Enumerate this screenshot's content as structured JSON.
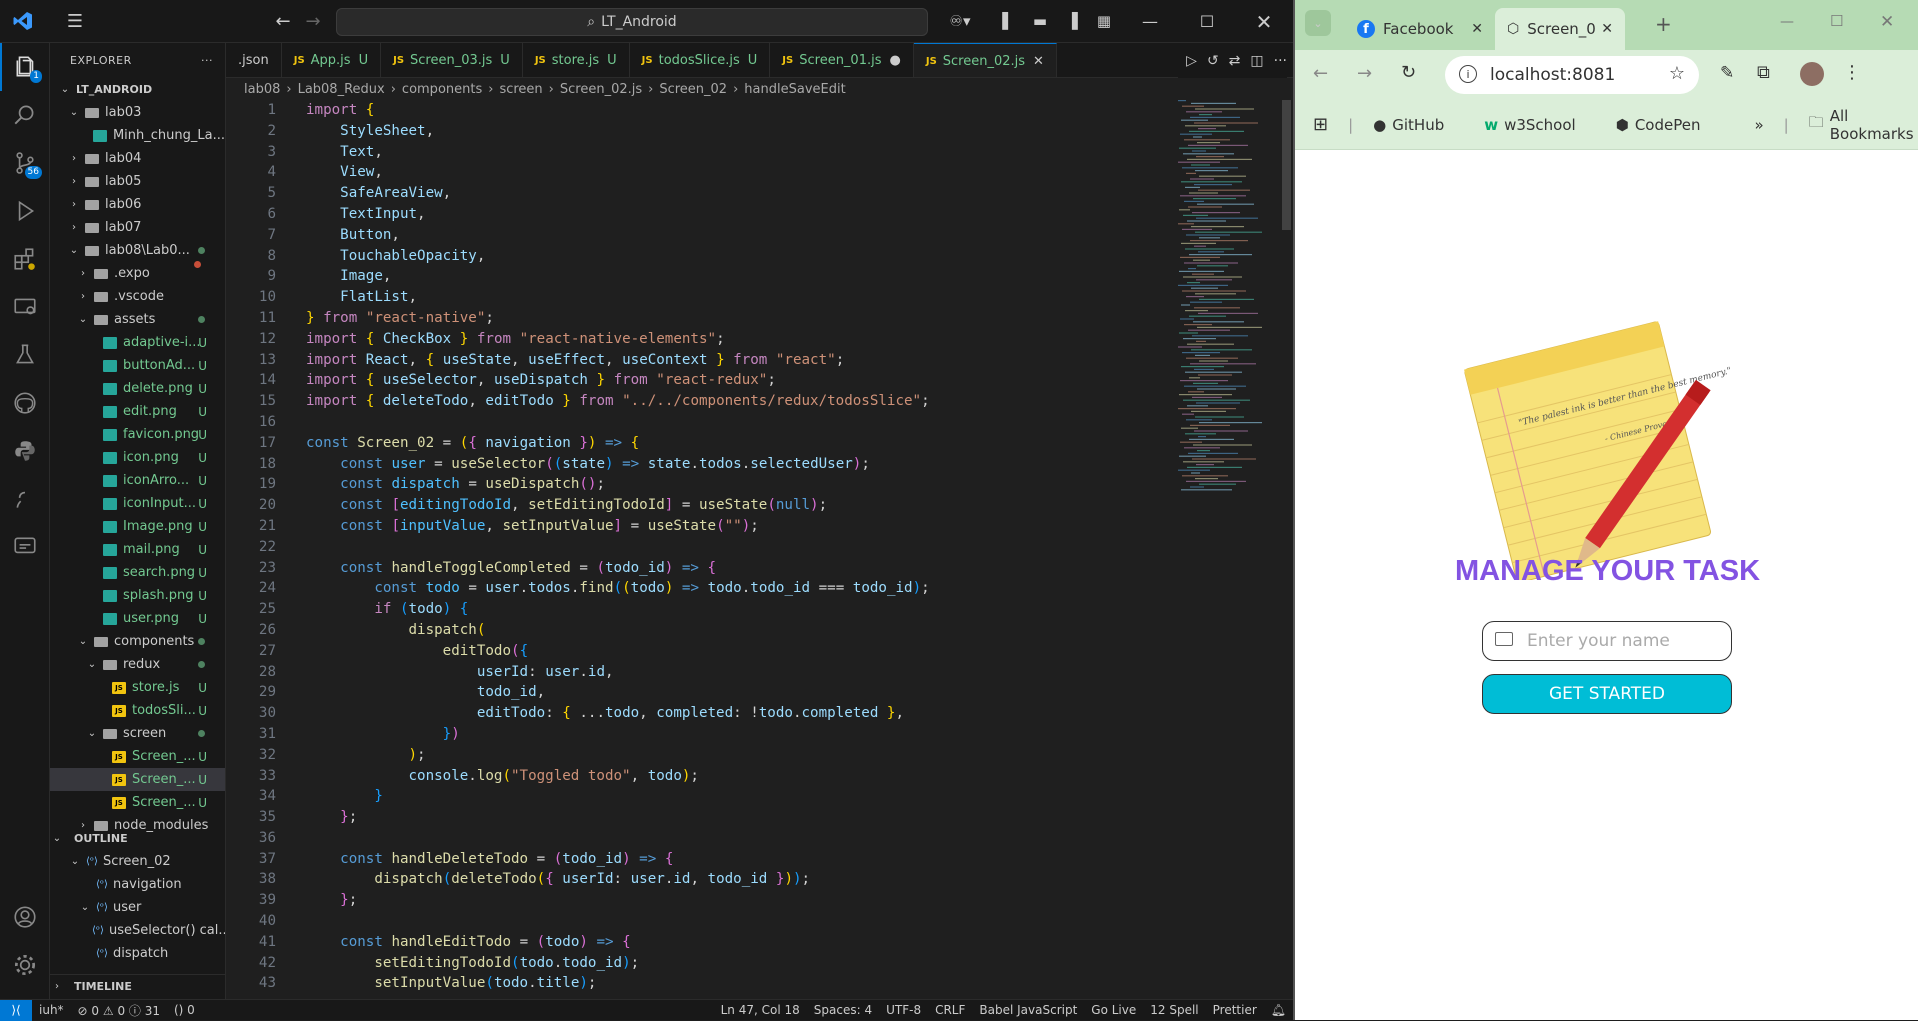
{
  "vscode": {
    "search": "LT_Android",
    "explorer_title": "EXPLORER",
    "scm_badge": "56",
    "ext_badge": "1",
    "tree": [
      {
        "label": "LT_ANDROID",
        "depth": 0,
        "type": "root",
        "open": true
      },
      {
        "label": "lab03",
        "depth": 1,
        "type": "folder",
        "open": true
      },
      {
        "label": "Minh_chung_La...",
        "depth": 2,
        "type": "file"
      },
      {
        "label": "lab04",
        "depth": 1,
        "type": "folder"
      },
      {
        "label": "lab05",
        "depth": 1,
        "type": "folder"
      },
      {
        "label": "lab06",
        "depth": 1,
        "type": "folder"
      },
      {
        "label": "lab07",
        "depth": 1,
        "type": "folder"
      },
      {
        "label": "lab08\\Lab0...",
        "depth": 1,
        "type": "folder",
        "open": true,
        "dot": true
      },
      {
        "label": ".expo",
        "depth": 2,
        "type": "folder"
      },
      {
        "label": ".vscode",
        "depth": 2,
        "type": "folder"
      },
      {
        "label": "assets",
        "depth": 2,
        "type": "folder",
        "open": true,
        "dot": true
      },
      {
        "label": "adaptive-i...",
        "depth": 3,
        "type": "png",
        "u": "U"
      },
      {
        "label": "buttonAd...",
        "depth": 3,
        "type": "png",
        "u": "U"
      },
      {
        "label": "delete.png",
        "depth": 3,
        "type": "png",
        "u": "U"
      },
      {
        "label": "edit.png",
        "depth": 3,
        "type": "png",
        "u": "U"
      },
      {
        "label": "favicon.png",
        "depth": 3,
        "type": "png",
        "u": "U"
      },
      {
        "label": "icon.png",
        "depth": 3,
        "type": "png",
        "u": "U"
      },
      {
        "label": "iconArro...",
        "depth": 3,
        "type": "png",
        "u": "U"
      },
      {
        "label": "iconInput...",
        "depth": 3,
        "type": "png",
        "u": "U"
      },
      {
        "label": "Image.png",
        "depth": 3,
        "type": "png",
        "u": "U"
      },
      {
        "label": "mail.png",
        "depth": 3,
        "type": "png",
        "u": "U"
      },
      {
        "label": "search.png",
        "depth": 3,
        "type": "png",
        "u": "U"
      },
      {
        "label": "splash.png",
        "depth": 3,
        "type": "png",
        "u": "U"
      },
      {
        "label": "user.png",
        "depth": 3,
        "type": "png",
        "u": "U"
      },
      {
        "label": "components",
        "depth": 2,
        "type": "folder",
        "open": true,
        "dot": true
      },
      {
        "label": "redux",
        "depth": 3,
        "type": "folder",
        "open": true,
        "dot": true
      },
      {
        "label": "store.js",
        "depth": 4,
        "type": "js",
        "u": "U"
      },
      {
        "label": "todosSli...",
        "depth": 4,
        "type": "js",
        "u": "U"
      },
      {
        "label": "screen",
        "depth": 3,
        "type": "folder",
        "open": true,
        "dot": true
      },
      {
        "label": "Screen_...",
        "depth": 4,
        "type": "js",
        "u": "U"
      },
      {
        "label": "Screen_...",
        "depth": 4,
        "type": "js",
        "u": "U",
        "selected": true
      },
      {
        "label": "Screen_...",
        "depth": 4,
        "type": "js",
        "u": "U"
      },
      {
        "label": "node_modules",
        "depth": 2,
        "type": "folder"
      }
    ],
    "outline_title": "OUTLINE",
    "outline": [
      {
        "label": "Screen_02",
        "depth": 1
      },
      {
        "label": "navigation",
        "depth": 2
      },
      {
        "label": "user",
        "depth": 2
      },
      {
        "label": "useSelector() cal...",
        "depth": 3
      },
      {
        "label": "dispatch",
        "depth": 2
      }
    ],
    "timeline_title": "TIMELINE",
    "tabs": [
      {
        "label": ".json",
        "u": ""
      },
      {
        "label": "App.js",
        "u": "U"
      },
      {
        "label": "Screen_03.js",
        "u": "U"
      },
      {
        "label": "store.js",
        "u": "U"
      },
      {
        "label": "todosSlice.js",
        "u": "U"
      },
      {
        "label": "Screen_01.js",
        "u": "●"
      },
      {
        "label": "Screen_02.js",
        "u": "✕",
        "active": true
      }
    ],
    "breadcrumbs": [
      "lab08",
      "Lab08_Redux",
      "components",
      "screen",
      "Screen_02.js",
      "Screen_02",
      "handleSaveEdit"
    ],
    "status": {
      "branch": "iuh*",
      "problems": "⊘ 0 ⚠ 0 ⓘ 31",
      "ports": "() 0",
      "position": "Ln 47, Col 18",
      "spaces": "Spaces: 4",
      "encoding": "UTF-8",
      "eol": "CRLF",
      "language": "Babel JavaScript",
      "golive": "Go Live",
      "spell": "12 Spell",
      "prettier": "Prettier"
    }
  },
  "code_lines": [
    "<span class='k'>import</span> <span class='br'>{</span>",
    "    <span class='v'>StyleSheet</span>,",
    "    <span class='v'>Text</span>,",
    "    <span class='v'>View</span>,",
    "    <span class='v'>SafeAreaView</span>,",
    "    <span class='v'>TextInput</span>,",
    "    <span class='v'>Button</span>,",
    "    <span class='v'>TouchableOpacity</span>,",
    "    <span class='v'>Image</span>,",
    "    <span class='v'>FlatList</span>,",
    "<span class='br'>}</span> <span class='k'>from</span> <span class='s'>\"react-native\"</span>;",
    "<span class='k'>import</span> <span class='br'>{</span> <span class='v'>CheckBox</span> <span class='br'>}</span> <span class='k'>from</span> <span class='s'>\"react-native-elements\"</span>;",
    "<span class='k'>import</span> <span class='v'>React</span>, <span class='br'>{</span> <span class='v'>useState</span>, <span class='v'>useEffect</span>, <span class='v'>useContext</span> <span class='br'>}</span> <span class='k'>from</span> <span class='s'>\"react\"</span>;",
    "<span class='k'>import</span> <span class='br'>{</span> <span class='v'>useSelector</span>, <span class='v'>useDispatch</span> <span class='br'>}</span> <span class='k'>from</span> <span class='s'>\"react-redux\"</span>;",
    "<span class='k'>import</span> <span class='br'>{</span> <span class='v'>deleteTodo</span>, <span class='v'>editTodo</span> <span class='br'>}</span> <span class='k'>from</span> <span class='s'>\"../../components/redux/todosSlice\"</span>;",
    "",
    "<span class='b'>const</span> <span class='f'>Screen_02</span> = <span class='br'>(</span><span class='bm'>{</span> <span class='v'>navigation</span> <span class='bm'>}</span><span class='br'>)</span> <span class='b'>=&gt;</span> <span class='br'>{</span>",
    "    <span class='b'>const</span> <span class='c'>user</span> = <span class='f'>useSelector</span><span class='bm'>(</span><span class='bb'>(</span><span class='v'>state</span><span class='bb'>)</span> <span class='b'>=&gt;</span> <span class='v'>state</span>.<span class='v'>todos</span>.<span class='v'>selectedUser</span><span class='bm'>)</span>;",
    "    <span class='b'>const</span> <span class='c'>dispatch</span> = <span class='f'>useDispatch</span><span class='bm'>()</span>;",
    "    <span class='b'>const</span> <span class='bm'>[</span><span class='c'>editingTodoId</span>, <span class='f'>setEditingTodoId</span><span class='bm'>]</span> = <span class='f'>useState</span><span class='bm'>(</span><span class='b'>null</span><span class='bm'>)</span>;",
    "    <span class='b'>const</span> <span class='bm'>[</span><span class='c'>inputValue</span>, <span class='f'>setInputValue</span><span class='bm'>]</span> = <span class='f'>useState</span><span class='bm'>(</span><span class='s'>\"\"</span><span class='bm'>)</span>;",
    "",
    "    <span class='b'>const</span> <span class='f'>handleToggleCompleted</span> = <span class='bm'>(</span><span class='v'>todo_id</span><span class='bm'>)</span> <span class='b'>=&gt;</span> <span class='bm'>{</span>",
    "        <span class='b'>const</span> <span class='c'>todo</span> = <span class='v'>user</span>.<span class='v'>todos</span>.<span class='f'>find</span><span class='bb'>(</span><span class='br'>(</span><span class='v'>todo</span><span class='br'>)</span> <span class='b'>=&gt;</span> <span class='v'>todo</span>.<span class='v'>todo_id</span> === <span class='v'>todo_id</span><span class='bb'>)</span>;",
    "        <span class='k'>if</span> <span class='bb'>(</span><span class='v'>todo</span><span class='bb'>)</span> <span class='bb'>{</span>",
    "            <span class='f'>dispatch</span><span class='br'>(</span>",
    "                <span class='f'>editTodo</span><span class='bm'>(</span><span class='bb'>{</span>",
    "                    <span class='v'>userId</span>: <span class='v'>user</span>.<span class='v'>id</span>,",
    "                    <span class='v'>todo_id</span>,",
    "                    <span class='v'>editTodo</span>: <span class='br'>{</span> ...<span class='v'>todo</span>, <span class='v'>completed</span>: !<span class='v'>todo</span>.<span class='v'>completed</span> <span class='br'>}</span>,",
    "                <span class='bb'>}</span><span class='bm'>)</span>",
    "            <span class='br'>)</span>;",
    "            <span class='v'>console</span>.<span class='f'>log</span><span class='br'>(</span><span class='s'>\"Toggled todo\"</span>, <span class='v'>todo</span><span class='br'>)</span>;",
    "        <span class='bb'>}</span>",
    "    <span class='bm'>}</span>;",
    "",
    "    <span class='b'>const</span> <span class='f'>handleDeleteTodo</span> = <span class='bm'>(</span><span class='v'>todo_id</span><span class='bm'>)</span> <span class='b'>=&gt;</span> <span class='bm'>{</span>",
    "        <span class='f'>dispatch</span><span class='bb'>(</span><span class='f'>deleteTodo</span><span class='br'>(</span><span class='bm'>{</span> <span class='v'>userId</span>: <span class='v'>user</span>.<span class='v'>id</span>, <span class='v'>todo_id</span> <span class='bm'>}</span><span class='br'>)</span><span class='bb'>)</span>;",
    "    <span class='bm'>}</span>;",
    "",
    "    <span class='b'>const</span> <span class='f'>handleEditTodo</span> = <span class='bm'>(</span><span class='v'>todo</span><span class='bm'>)</span> <span class='b'>=&gt;</span> <span class='bm'>{</span>",
    "        <span class='f'>setEditingTodoId</span><span class='bb'>(</span><span class='v'>todo</span>.<span class='v'>todo_id</span><span class='bb'>)</span>;",
    "        <span class='f'>setInputValue</span><span class='bb'>(</span><span class='v'>todo</span>.<span class='v'>title</span><span class='bb'>)</span>;"
  ],
  "chrome": {
    "tabs": [
      {
        "label": "Facebook"
      },
      {
        "label": "Screen_0",
        "active": true
      }
    ],
    "url": "localhost:8081",
    "bookmarks": [
      "GitHub",
      "w3School",
      "CodePen"
    ],
    "all_bookmarks": "All Bookmarks",
    "app": {
      "note_quote": "\"The palest ink is better than the best memory.\"",
      "note_author": "- Chinese Proverb",
      "title": "MANAGE YOUR TASK",
      "input_placeholder": "Enter your name",
      "button": "GET STARTED",
      "accent": "#8353e2",
      "button_color": "#00bdd6"
    }
  }
}
